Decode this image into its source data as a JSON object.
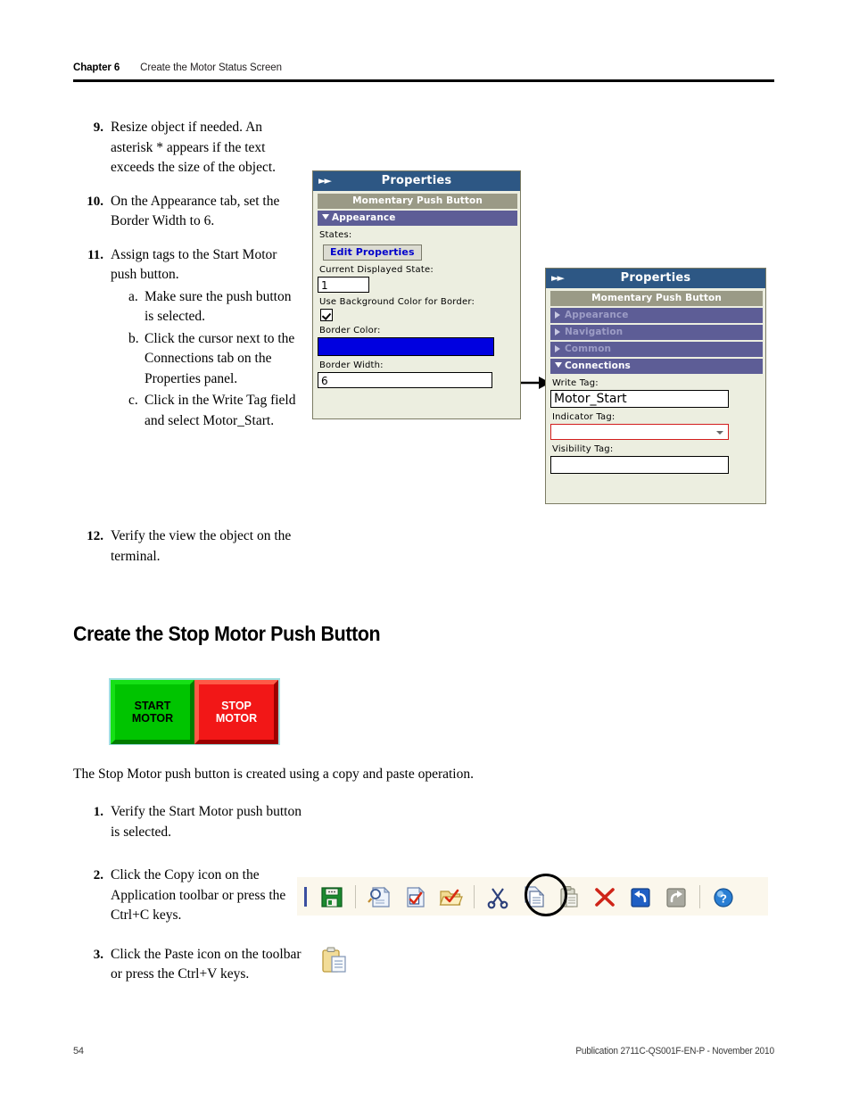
{
  "header": {
    "chapter": "Chapter 6",
    "title": "Create the Motor Status Screen"
  },
  "steps_top": [
    {
      "num": "9.",
      "text": "Resize object if needed. An asterisk * appears if the text exceeds the size of the object.",
      "substeps": []
    },
    {
      "num": "10.",
      "text": "On the Appearance tab, set the Border Width to 6.",
      "substeps": []
    },
    {
      "num": "11.",
      "text": "Assign tags to the Start Motor push button.",
      "substeps": [
        {
          "letter": "a.",
          "text": "Make sure the push button is selected."
        },
        {
          "letter": "b.",
          "text": "Click the cursor next to the Connections tab on the Properties panel."
        },
        {
          "letter": "c.",
          "text": "Click in the Write Tag field and select Motor_Start."
        }
      ]
    }
  ],
  "step_12": {
    "num": "12.",
    "text": "Verify the view the object on the terminal."
  },
  "section_heading": "Create the Stop Motor Push Button",
  "pushbutton_figure": {
    "start_line1": "START",
    "start_line2": "MOTOR",
    "stop_line1": "STOP",
    "stop_line2": "MOTOR",
    "start_color": "#00c400",
    "stop_color": "#f21717",
    "backdrop_color": "#9fdfe0"
  },
  "intro_paragraph": "The Stop Motor push button is created using a copy and paste operation.",
  "steps_bottom": [
    {
      "num": "1.",
      "text": "Verify the Start Motor push button is selected."
    },
    {
      "num": "2.",
      "text": "Click the Copy icon on the Application toolbar or press the Ctrl+C keys."
    },
    {
      "num": "3.",
      "text": "Click the Paste icon on the toolbar or press the Ctrl+V keys."
    }
  ],
  "panel_appearance": {
    "titlebar": "Properties",
    "object_name": "Momentary Push Button",
    "section_label": "Appearance",
    "states_label": "States:",
    "edit_properties_button": "Edit Properties",
    "current_state_label": "Current Displayed State:",
    "current_state_value": "1",
    "use_bg_color_label": "Use Background Color for Border:",
    "border_color_label": "Border Color:",
    "border_color_value": "#0000e0",
    "border_width_label": "Border Width:",
    "border_width_value": "6"
  },
  "panel_connections": {
    "titlebar": "Properties",
    "object_name": "Momentary Push Button",
    "tabs": [
      {
        "label": "Appearance",
        "expanded": false
      },
      {
        "label": "Navigation",
        "expanded": false
      },
      {
        "label": "Common",
        "expanded": false
      },
      {
        "label": "Connections",
        "expanded": true
      }
    ],
    "write_tag_label": "Write Tag:",
    "write_tag_value": "Motor_Start",
    "indicator_tag_label": "Indicator Tag:",
    "indicator_tag_value": "",
    "visibility_tag_label": "Visibility Tag:",
    "visibility_tag_value": ""
  },
  "toolbar": {
    "icons": [
      "save-icon",
      "preview-icon",
      "validate-document-icon",
      "open-folder-check-icon",
      "cut-scissors-icon",
      "copy-icon",
      "paste-icon",
      "delete-x-icon",
      "undo-icon",
      "redo-icon",
      "help-icon"
    ],
    "highlighted_icon": "copy-icon",
    "standalone_icon": "paste-icon"
  },
  "footer": {
    "page_number": "54",
    "publication": "Publication 2711C-QS001F-EN-P - November 2010"
  }
}
